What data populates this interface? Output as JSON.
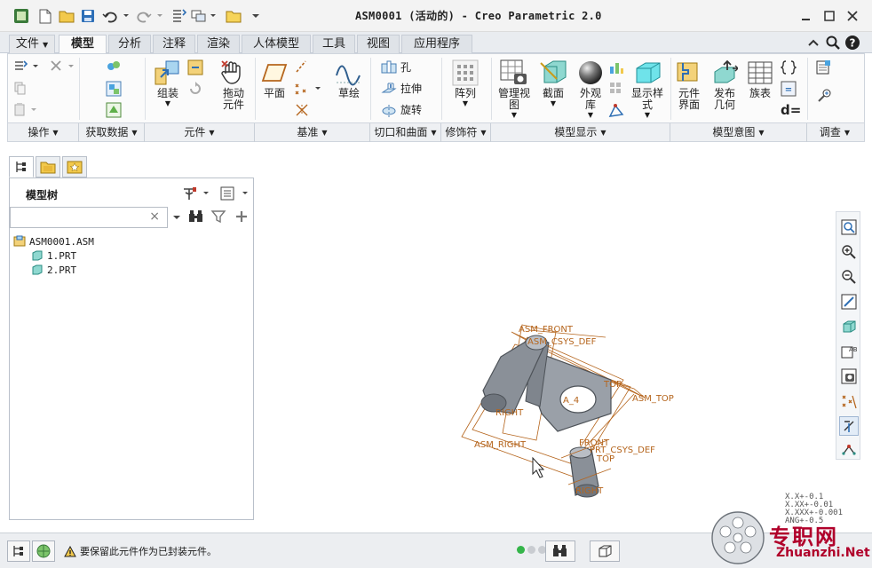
{
  "window": {
    "title": "ASM0001 (活动的) - Creo Parametric 2.0"
  },
  "tabs": [
    {
      "label": "文件"
    },
    {
      "label": "模型"
    },
    {
      "label": "分析"
    },
    {
      "label": "注释"
    },
    {
      "label": "渲染"
    },
    {
      "label": "人体模型"
    },
    {
      "label": "工具"
    },
    {
      "label": "视图"
    },
    {
      "label": "应用程序"
    }
  ],
  "ribbon": {
    "assemble": "组装",
    "drag_components": "拖动\n元件",
    "plane": "平面",
    "sketch": "草绘",
    "hole": "孔",
    "extrude": "拉伸",
    "revolve": "旋转",
    "pattern": "阵列",
    "manage_views": "管理视\n图",
    "section": "截面",
    "appearance": "外观\n库",
    "display_style": "显示样\n式",
    "component_interface": "元件\n界面",
    "publish_geometry": "发布\n几何",
    "family_table": "族表",
    "dimension_symbol": "d="
  },
  "groups": [
    {
      "label": "操作"
    },
    {
      "label": "获取数据"
    },
    {
      "label": "元件"
    },
    {
      "label": "基准"
    },
    {
      "label": "切口和曲面"
    },
    {
      "label": "修饰符"
    },
    {
      "label": "模型显示"
    },
    {
      "label": "模型意图"
    },
    {
      "label": "调查"
    }
  ],
  "model_tree": {
    "title": "模型树",
    "items": [
      {
        "label": "ASM0001.ASM"
      },
      {
        "label": "1.PRT"
      },
      {
        "label": "2.PRT"
      }
    ]
  },
  "viewport": {
    "labels": {
      "asm_front": "ASM_FRONT",
      "asm_csys_def": "ASM_CSYS_DEF",
      "asm_top": "ASM_TOP",
      "asm_right": "ASM_RIGHT",
      "top1": "TOP",
      "right1": "RIGHT",
      "axis": "A_4",
      "front2": "FRONT",
      "prt_csys_def": "PRT_CSYS_DEF",
      "top2": "TOP",
      "right2": "RIGHT"
    },
    "tolerances": [
      "X.X+-0.1",
      "X.XX+-0.01",
      "X.XXX+-0.001",
      "ANG+-0.5"
    ]
  },
  "status": {
    "message": "要保留此元件作为已封装元件。"
  },
  "watermark": {
    "cn": "专职网",
    "url": "Zhuanzhi.Net"
  },
  "colors": {
    "accent": "#2f6fb4",
    "datum": "#b5651d",
    "model": "#8a9098"
  }
}
